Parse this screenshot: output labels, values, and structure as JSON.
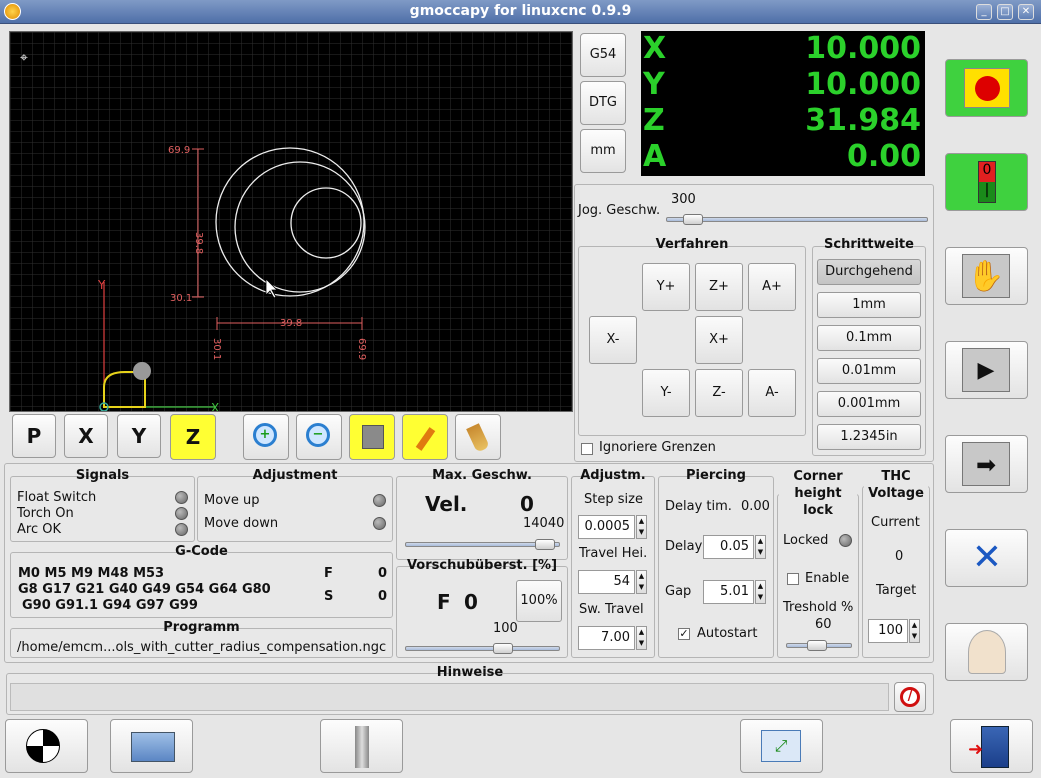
{
  "window": {
    "title": "gmoccapy for linuxcnc 0.9.9"
  },
  "dro": {
    "x_label": "X",
    "x": "10.000",
    "y_label": "Y",
    "y": "10.000",
    "z_label": "Z",
    "z": "31.984",
    "a_label": "A",
    "a": "0.00"
  },
  "mode_buttons": {
    "g54": "G54",
    "dtg": "DTG",
    "units": "mm"
  },
  "plot": {
    "dim_top": "69.9",
    "dim_vert": "39.8",
    "dim_bottom": "30.1",
    "dim_horiz": "39.8",
    "dim_h_left": "30.1",
    "dim_h_right": "69.9",
    "axis_y": "Y",
    "axis_x": "X"
  },
  "jog": {
    "label": "Jog. Geschw.",
    "value": "300",
    "speed_fraction": 0.07,
    "verfahren_title": "Verfahren",
    "schrittweite_title": "Schrittweite",
    "buttons": {
      "yplus": "Y+",
      "zplus": "Z+",
      "aplus": "A+",
      "xminus": "X-",
      "xplus": "X+",
      "yminus": "Y-",
      "zminus": "Z-",
      "aminus": "A-"
    },
    "increments": [
      "Durchgehend",
      "1mm",
      "0.1mm",
      "0.01mm",
      "0.001mm",
      "1.2345in"
    ],
    "ignore_limits": "Ignoriere Grenzen"
  },
  "signals": {
    "title": "Signals",
    "items": [
      "Float Switch",
      "Torch On",
      "Arc OK"
    ]
  },
  "adjustment": {
    "title": "Adjustment",
    "items": [
      "Move up",
      "Move down"
    ]
  },
  "maxvel": {
    "title": "Max. Geschw.",
    "label": "Vel.",
    "value": "0",
    "max": "14040",
    "fraction": 0.96
  },
  "gcode": {
    "title": "G-Code",
    "line1": "M0 M5 M9 M48 M53",
    "line2": "G8 G17 G21 G40 G49 G54 G64 G80",
    "line3": "G90 G91.1 G94 G97 G99",
    "f_label": "F",
    "f_value": "0",
    "s_label": "S",
    "s_value": "0"
  },
  "programm": {
    "title": "Programm",
    "path": "/home/emcm...ols_with_cutter_radius_compensation.ngc"
  },
  "feed": {
    "title": "Vorschubüberst. [%]",
    "f_label": "F",
    "f_value": "0",
    "reset": "100%",
    "value": "100",
    "fraction": 0.65
  },
  "adjustm": {
    "title": "Adjustm.",
    "step_label": "Step size",
    "step": "0.0005",
    "travel_label": "Travel Hei.",
    "travel": "54",
    "sw_label": "Sw. Travel",
    "sw": "7.00"
  },
  "piercing": {
    "title": "Piercing",
    "delay_time_label": "Delay tim.",
    "delay_time": "0.00",
    "delay_label": "Delay",
    "delay": "0.05",
    "gap_label": "Gap",
    "gap": "5.01",
    "autostart": "Autostart",
    "autostart_checked": true
  },
  "chl": {
    "title": "Corner height lock",
    "locked": "Locked",
    "enable": "Enable",
    "treshold_label": "Treshold %",
    "treshold": "60",
    "fraction": 0.45
  },
  "thc": {
    "title": "THC Voltage",
    "current_label": "Current",
    "current": "0",
    "target_label": "Target",
    "target": "100"
  },
  "hinweise": {
    "title": "Hinweise"
  },
  "colors": {
    "estop_green": "#3fd13f",
    "dro_green": "#2bd12b",
    "dro_bg": "#000000",
    "highlight_yellow": "#ffff33"
  }
}
